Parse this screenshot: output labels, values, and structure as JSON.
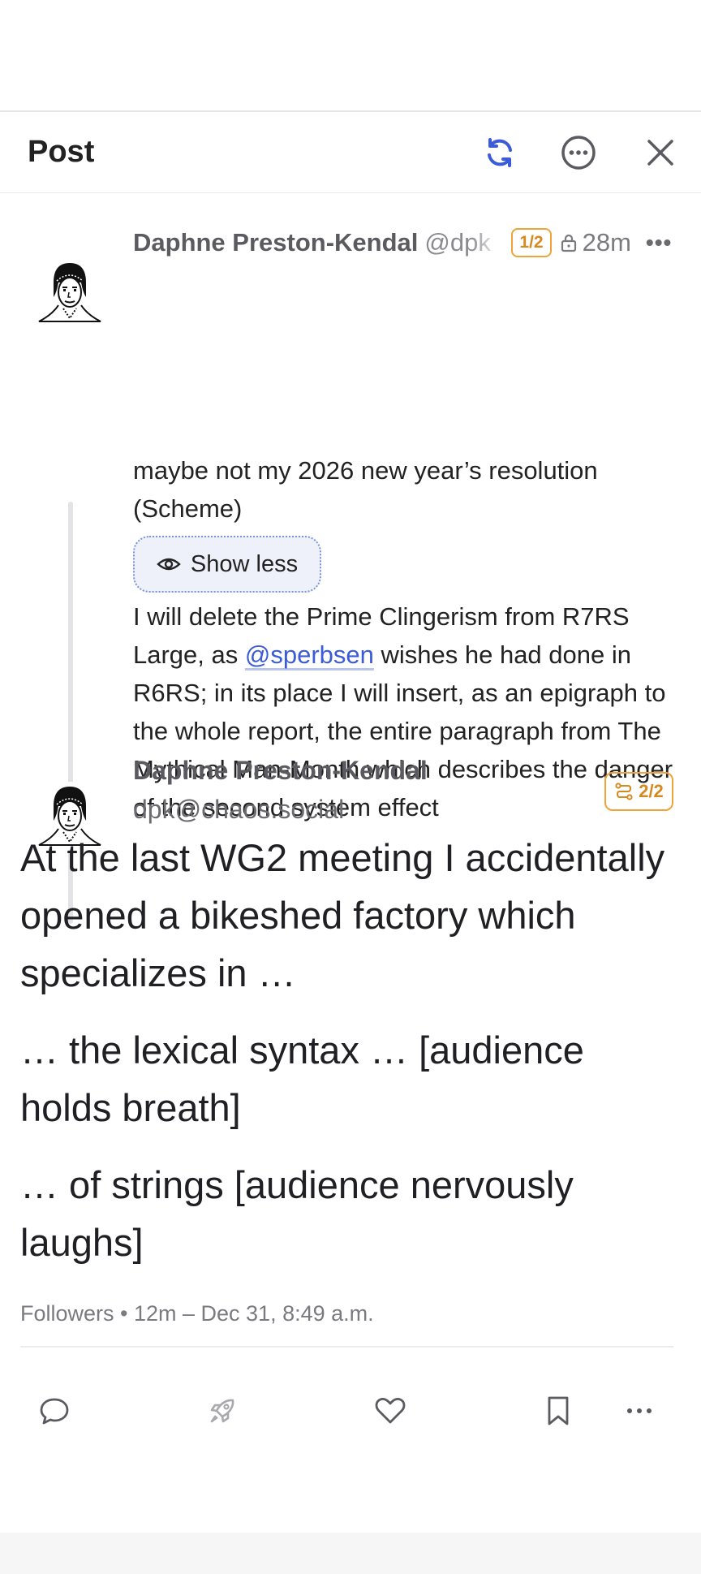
{
  "header": {
    "title": "Post"
  },
  "parent_post": {
    "author_name": "Daphne Preston-Kendal",
    "handle": "@dpk",
    "thread_count": "1/2",
    "time": "28m",
    "content_warning": "maybe not my 2026 new year’s resolution (Scheme)",
    "show_less_label": "Show less",
    "body_before_mention": "I will delete the Prime Clingerism from R7RS Large, as ",
    "mention": "@sperbsen",
    "body_after_mention": " wishes he had done in R6RS; in its place I will insert, as an epigraph to the whole report, the entire paragraph from The Mythical Man-Month which describes the danger of the second system effect"
  },
  "main_post": {
    "author_name": "Daphne Preston-Kendal",
    "account": "dpk@chaos.social",
    "thread_badge": "2/2",
    "paragraphs": [
      "At the last WG2 meeting I accidentally opened a bikeshed factory which specializes in …",
      "… the lexical syntax … [audience holds breath]",
      "… of strings [audience nervously laughs]"
    ],
    "meta": "Followers • 12m – Dec 31, 8:49 a.m."
  },
  "icons": {
    "refresh": "refresh-icon",
    "more": "more-circle-icon",
    "close": "close-icon",
    "reply": "reply-icon",
    "boost": "rocket-icon",
    "like": "heart-icon",
    "bookmark": "bookmark-icon",
    "actions_more": "more-horizontal-icon"
  },
  "colors": {
    "accent_blue": "#3b5bd8",
    "badge_orange": "#f0a33a"
  }
}
